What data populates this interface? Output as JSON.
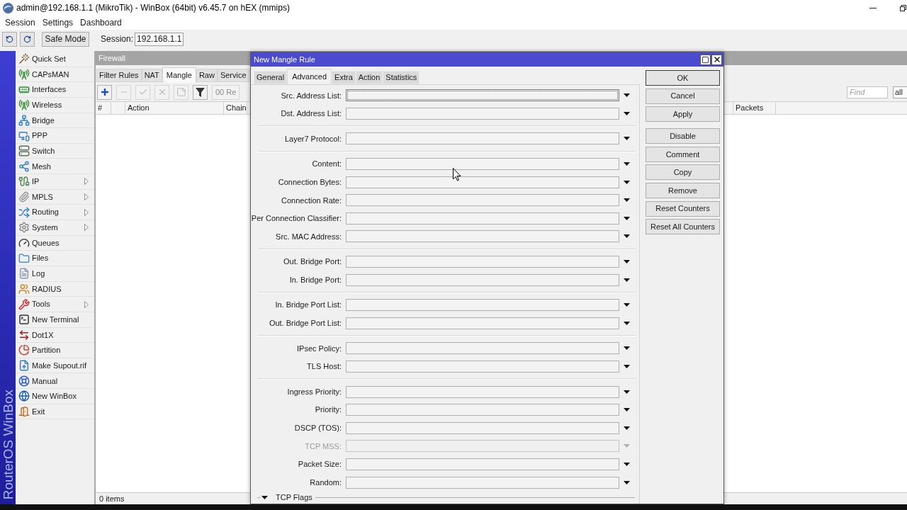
{
  "window": {
    "title": "admin@192.168.1.1 (MikroTik) - WinBox (64bit) v6.45.7 on hEX (mmips)"
  },
  "menu": [
    "Session",
    "Settings",
    "Dashboard"
  ],
  "toolbar": {
    "safe_mode": "Safe Mode",
    "session_label": "Session:",
    "session": "192.168.1.1"
  },
  "side_banner": "RouterOS WinBox",
  "sidebar": {
    "items": [
      {
        "label": "Quick Set",
        "has_submenu": false
      },
      {
        "label": "CAPsMAN",
        "has_submenu": false
      },
      {
        "label": "Interfaces",
        "has_submenu": false
      },
      {
        "label": "Wireless",
        "has_submenu": false
      },
      {
        "label": "Bridge",
        "has_submenu": false
      },
      {
        "label": "PPP",
        "has_submenu": false
      },
      {
        "label": "Switch",
        "has_submenu": false
      },
      {
        "label": "Mesh",
        "has_submenu": false
      },
      {
        "label": "IP",
        "has_submenu": true
      },
      {
        "label": "MPLS",
        "has_submenu": true
      },
      {
        "label": "Routing",
        "has_submenu": true
      },
      {
        "label": "System",
        "has_submenu": true
      },
      {
        "label": "Queues",
        "has_submenu": false
      },
      {
        "label": "Files",
        "has_submenu": false
      },
      {
        "label": "Log",
        "has_submenu": false
      },
      {
        "label": "RADIUS",
        "has_submenu": false
      },
      {
        "label": "Tools",
        "has_submenu": true
      },
      {
        "label": "New Terminal",
        "has_submenu": false
      },
      {
        "label": "Dot1X",
        "has_submenu": false
      },
      {
        "label": "Partition",
        "has_submenu": false
      },
      {
        "label": "Make Supout.rif",
        "has_submenu": false
      },
      {
        "label": "Manual",
        "has_submenu": false
      },
      {
        "label": "New WinBox",
        "has_submenu": false
      },
      {
        "label": "Exit",
        "has_submenu": false
      }
    ]
  },
  "firewall": {
    "title": "Firewall",
    "tabs": [
      {
        "label": "Filter Rules",
        "selected": false
      },
      {
        "label": "NAT",
        "selected": false
      },
      {
        "label": "Mangle",
        "selected": true
      },
      {
        "label": "Raw",
        "selected": false
      },
      {
        "label": "Service",
        "selected": false
      }
    ],
    "toolbar": {
      "buttons": [
        {
          "kind": "add",
          "disabled": false
        },
        {
          "kind": "remove",
          "disabled": true
        },
        {
          "kind": "enable",
          "disabled": true
        },
        {
          "kind": "disable",
          "disabled": true
        },
        {
          "kind": "comment",
          "disabled": true
        },
        {
          "kind": "filter",
          "disabled": false
        }
      ],
      "reset": {
        "label": "00 Re",
        "disabled": true
      }
    },
    "find": {
      "placeholder": "Find"
    },
    "filter": "all",
    "columns": [
      "#",
      "Action",
      "Chain",
      "Packets"
    ],
    "status": "0 items"
  },
  "dialog": {
    "title": "New Mangle Rule",
    "tabs": [
      {
        "label": "General",
        "selected": false
      },
      {
        "label": "Advanced",
        "selected": true
      },
      {
        "label": "Extra",
        "selected": false
      },
      {
        "label": "Action",
        "selected": false
      },
      {
        "label": "Statistics",
        "selected": false
      }
    ],
    "groups": [
      {
        "fields": [
          {
            "label": "Src. Address List:",
            "focused": true,
            "disabled": false
          },
          {
            "label": "Dst. Address List:",
            "focused": false,
            "disabled": false
          }
        ]
      },
      {
        "fields": [
          {
            "label": "Layer7 Protocol:",
            "focused": false,
            "disabled": false
          }
        ]
      },
      {
        "fields": [
          {
            "label": "Content:",
            "focused": false,
            "disabled": false
          },
          {
            "label": "Connection Bytes:",
            "focused": false,
            "disabled": false
          },
          {
            "label": "Connection Rate:",
            "focused": false,
            "disabled": false
          },
          {
            "label": "Per Connection Classifier:",
            "focused": false,
            "disabled": false
          },
          {
            "label": "Src. MAC Address:",
            "focused": false,
            "disabled": false
          }
        ]
      },
      {
        "fields": [
          {
            "label": "Out. Bridge Port:",
            "focused": false,
            "disabled": false
          },
          {
            "label": "In. Bridge Port:",
            "focused": false,
            "disabled": false
          }
        ]
      },
      {
        "fields": [
          {
            "label": "In. Bridge Port List:",
            "focused": false,
            "disabled": false
          },
          {
            "label": "Out. Bridge Port List:",
            "focused": false,
            "disabled": false
          }
        ]
      },
      {
        "fields": [
          {
            "label": "IPsec Policy:",
            "focused": false,
            "disabled": false
          },
          {
            "label": "TLS Host:",
            "focused": false,
            "disabled": false
          }
        ]
      },
      {
        "fields": [
          {
            "label": "Ingress Priority:",
            "focused": false,
            "disabled": false
          },
          {
            "label": "Priority:",
            "focused": false,
            "disabled": false
          },
          {
            "label": "DSCP (TOS):",
            "focused": false,
            "disabled": false
          },
          {
            "label": "TCP MSS:",
            "focused": false,
            "disabled": true
          },
          {
            "label": "Packet Size:",
            "focused": false,
            "disabled": false
          },
          {
            "label": "Random:",
            "focused": false,
            "disabled": false
          }
        ]
      }
    ],
    "section": {
      "label": "TCP Flags"
    },
    "button_groups": [
      [
        {
          "label": "OK",
          "default": true
        },
        {
          "label": "Cancel",
          "default": false
        },
        {
          "label": "Apply",
          "default": false
        }
      ],
      [
        {
          "label": "Disable",
          "default": false
        },
        {
          "label": "Comment",
          "default": false
        },
        {
          "label": "Copy",
          "default": false
        },
        {
          "label": "Remove",
          "default": false
        },
        {
          "label": "Reset Counters",
          "default": false
        },
        {
          "label": "Reset All Counters",
          "default": false
        }
      ]
    ]
  }
}
